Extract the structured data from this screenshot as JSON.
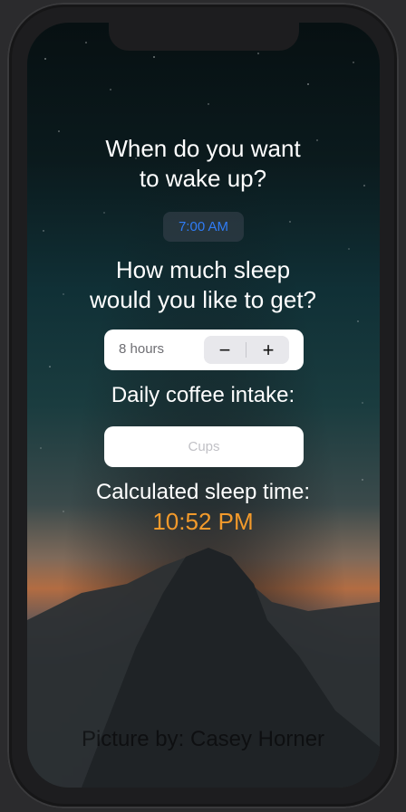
{
  "heading": {
    "line1": "When do you want",
    "line2": "to wake up?"
  },
  "wake_time": {
    "value": "7:00 AM",
    "accent_color": "#2f7cf6"
  },
  "sleep": {
    "line1": "How much sleep",
    "line2": "would you like to get?",
    "amount_text": "8 hours",
    "minus_label": "−",
    "plus_label": "+"
  },
  "coffee": {
    "label": "Daily coffee intake:",
    "placeholder": "Cups",
    "value": ""
  },
  "result": {
    "label": "Calculated sleep time:",
    "value": "10:52 PM",
    "accent_color": "#f39a2b"
  },
  "credit": {
    "text": "Picture by: Casey Horner"
  }
}
